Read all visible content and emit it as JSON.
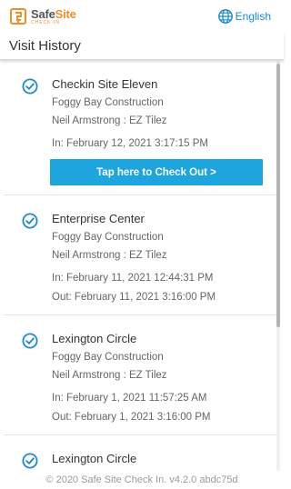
{
  "brand": {
    "name_part1": "Safe",
    "name_part2": "Site",
    "subtitle": "CHECK IN",
    "accent_color": "#f28c28"
  },
  "language": {
    "label": "English",
    "icon": "globe-icon"
  },
  "page": {
    "title": "Visit History"
  },
  "visits": [
    {
      "site": "Checkin Site Eleven",
      "company": "Foggy Bay Construction",
      "person": "Neil Armstrong : EZ Tilez",
      "in": "In: February 12, 2021 3:17:15 PM",
      "action_label": "Tap here to Check Out >"
    },
    {
      "site": "Enterprise Center",
      "company": "Foggy Bay Construction",
      "person": "Neil Armstrong : EZ Tilez",
      "in": "In: February 11, 2021 12:44:31 PM",
      "out": "Out: February 11, 2021 3:16:00 PM"
    },
    {
      "site": "Lexington Circle",
      "company": "Foggy Bay Construction",
      "person": "Neil Armstrong : EZ Tilez",
      "in": "In: February 1, 2021 11:57:25 AM",
      "out": "Out: February 1, 2021 3:16:00 PM"
    },
    {
      "site": "Lexington Circle"
    }
  ],
  "footer": {
    "text": "© 2020 Safe Site Check In. v4.2.0 abdc75d"
  },
  "colors": {
    "primary": "#1ea5dd",
    "check": "#1f8ac9",
    "text": "#333333",
    "muted": "#666666"
  }
}
